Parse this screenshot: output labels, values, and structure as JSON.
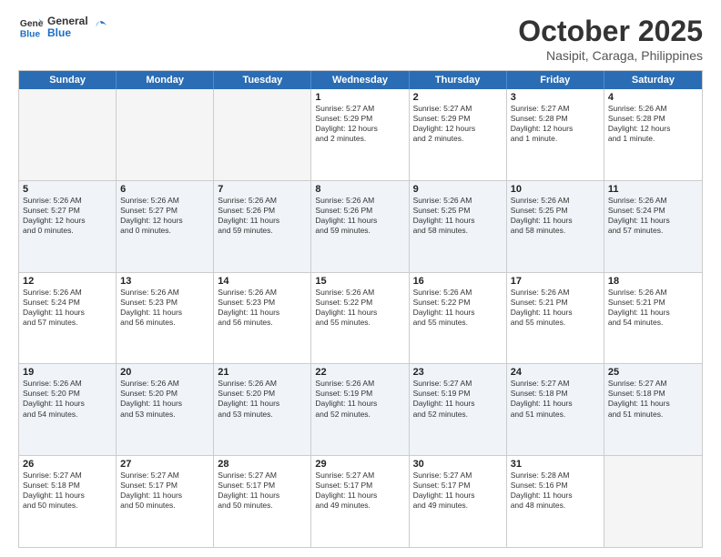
{
  "logo": {
    "general": "General",
    "blue": "Blue"
  },
  "header": {
    "month": "October 2025",
    "location": "Nasipit, Caraga, Philippines"
  },
  "weekdays": [
    "Sunday",
    "Monday",
    "Tuesday",
    "Wednesday",
    "Thursday",
    "Friday",
    "Saturday"
  ],
  "rows": [
    [
      {
        "day": "",
        "text": "",
        "empty": true
      },
      {
        "day": "",
        "text": "",
        "empty": true
      },
      {
        "day": "",
        "text": "",
        "empty": true
      },
      {
        "day": "1",
        "text": "Sunrise: 5:27 AM\nSunset: 5:29 PM\nDaylight: 12 hours\nand 2 minutes."
      },
      {
        "day": "2",
        "text": "Sunrise: 5:27 AM\nSunset: 5:29 PM\nDaylight: 12 hours\nand 2 minutes."
      },
      {
        "day": "3",
        "text": "Sunrise: 5:27 AM\nSunset: 5:28 PM\nDaylight: 12 hours\nand 1 minute."
      },
      {
        "day": "4",
        "text": "Sunrise: 5:26 AM\nSunset: 5:28 PM\nDaylight: 12 hours\nand 1 minute."
      }
    ],
    [
      {
        "day": "5",
        "text": "Sunrise: 5:26 AM\nSunset: 5:27 PM\nDaylight: 12 hours\nand 0 minutes."
      },
      {
        "day": "6",
        "text": "Sunrise: 5:26 AM\nSunset: 5:27 PM\nDaylight: 12 hours\nand 0 minutes."
      },
      {
        "day": "7",
        "text": "Sunrise: 5:26 AM\nSunset: 5:26 PM\nDaylight: 11 hours\nand 59 minutes."
      },
      {
        "day": "8",
        "text": "Sunrise: 5:26 AM\nSunset: 5:26 PM\nDaylight: 11 hours\nand 59 minutes."
      },
      {
        "day": "9",
        "text": "Sunrise: 5:26 AM\nSunset: 5:25 PM\nDaylight: 11 hours\nand 58 minutes."
      },
      {
        "day": "10",
        "text": "Sunrise: 5:26 AM\nSunset: 5:25 PM\nDaylight: 11 hours\nand 58 minutes."
      },
      {
        "day": "11",
        "text": "Sunrise: 5:26 AM\nSunset: 5:24 PM\nDaylight: 11 hours\nand 57 minutes."
      }
    ],
    [
      {
        "day": "12",
        "text": "Sunrise: 5:26 AM\nSunset: 5:24 PM\nDaylight: 11 hours\nand 57 minutes."
      },
      {
        "day": "13",
        "text": "Sunrise: 5:26 AM\nSunset: 5:23 PM\nDaylight: 11 hours\nand 56 minutes."
      },
      {
        "day": "14",
        "text": "Sunrise: 5:26 AM\nSunset: 5:23 PM\nDaylight: 11 hours\nand 56 minutes."
      },
      {
        "day": "15",
        "text": "Sunrise: 5:26 AM\nSunset: 5:22 PM\nDaylight: 11 hours\nand 55 minutes."
      },
      {
        "day": "16",
        "text": "Sunrise: 5:26 AM\nSunset: 5:22 PM\nDaylight: 11 hours\nand 55 minutes."
      },
      {
        "day": "17",
        "text": "Sunrise: 5:26 AM\nSunset: 5:21 PM\nDaylight: 11 hours\nand 55 minutes."
      },
      {
        "day": "18",
        "text": "Sunrise: 5:26 AM\nSunset: 5:21 PM\nDaylight: 11 hours\nand 54 minutes."
      }
    ],
    [
      {
        "day": "19",
        "text": "Sunrise: 5:26 AM\nSunset: 5:20 PM\nDaylight: 11 hours\nand 54 minutes."
      },
      {
        "day": "20",
        "text": "Sunrise: 5:26 AM\nSunset: 5:20 PM\nDaylight: 11 hours\nand 53 minutes."
      },
      {
        "day": "21",
        "text": "Sunrise: 5:26 AM\nSunset: 5:20 PM\nDaylight: 11 hours\nand 53 minutes."
      },
      {
        "day": "22",
        "text": "Sunrise: 5:26 AM\nSunset: 5:19 PM\nDaylight: 11 hours\nand 52 minutes."
      },
      {
        "day": "23",
        "text": "Sunrise: 5:27 AM\nSunset: 5:19 PM\nDaylight: 11 hours\nand 52 minutes."
      },
      {
        "day": "24",
        "text": "Sunrise: 5:27 AM\nSunset: 5:18 PM\nDaylight: 11 hours\nand 51 minutes."
      },
      {
        "day": "25",
        "text": "Sunrise: 5:27 AM\nSunset: 5:18 PM\nDaylight: 11 hours\nand 51 minutes."
      }
    ],
    [
      {
        "day": "26",
        "text": "Sunrise: 5:27 AM\nSunset: 5:18 PM\nDaylight: 11 hours\nand 50 minutes."
      },
      {
        "day": "27",
        "text": "Sunrise: 5:27 AM\nSunset: 5:17 PM\nDaylight: 11 hours\nand 50 minutes."
      },
      {
        "day": "28",
        "text": "Sunrise: 5:27 AM\nSunset: 5:17 PM\nDaylight: 11 hours\nand 50 minutes."
      },
      {
        "day": "29",
        "text": "Sunrise: 5:27 AM\nSunset: 5:17 PM\nDaylight: 11 hours\nand 49 minutes."
      },
      {
        "day": "30",
        "text": "Sunrise: 5:27 AM\nSunset: 5:17 PM\nDaylight: 11 hours\nand 49 minutes."
      },
      {
        "day": "31",
        "text": "Sunrise: 5:28 AM\nSunset: 5:16 PM\nDaylight: 11 hours\nand 48 minutes."
      },
      {
        "day": "",
        "text": "",
        "empty": true
      }
    ]
  ]
}
